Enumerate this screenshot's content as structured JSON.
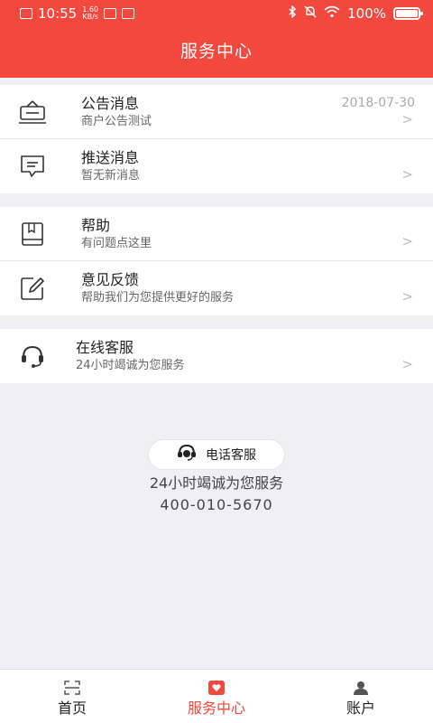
{
  "status_bar": {
    "time": "10:55",
    "net_speed_value": "1.60",
    "net_speed_unit": "KB/s",
    "battery": "100%"
  },
  "header": {
    "title": "服务中心"
  },
  "sections": [
    {
      "items": [
        {
          "title": "公告消息",
          "subtitle": "商户公告测试",
          "date": "2018-07-30",
          "icon": "announcement-icon"
        },
        {
          "title": "推送消息",
          "subtitle": "暂无新消息",
          "icon": "message-icon"
        }
      ]
    },
    {
      "items": [
        {
          "title": "帮助",
          "subtitle": "有问题点这里",
          "icon": "book-icon"
        },
        {
          "title": "意见反馈",
          "subtitle": "帮助我们为您提供更好的服务",
          "icon": "edit-icon"
        }
      ]
    },
    {
      "items": [
        {
          "title": "在线客服",
          "subtitle": "24小时竭诚为您服务",
          "icon": "headset-icon"
        }
      ]
    }
  ],
  "chevron": ">",
  "phone_service": {
    "button_label": "电话客服",
    "slogan": "24小时竭诚为您服务",
    "number": "400-010-5670"
  },
  "tabs": [
    {
      "label": "首页",
      "icon": "scan-icon",
      "active": false
    },
    {
      "label": "服务中心",
      "icon": "heart-icon",
      "active": true
    },
    {
      "label": "账户",
      "icon": "user-icon",
      "active": false
    }
  ],
  "colors": {
    "accent": "#f2483d",
    "background": "#efeff4"
  }
}
